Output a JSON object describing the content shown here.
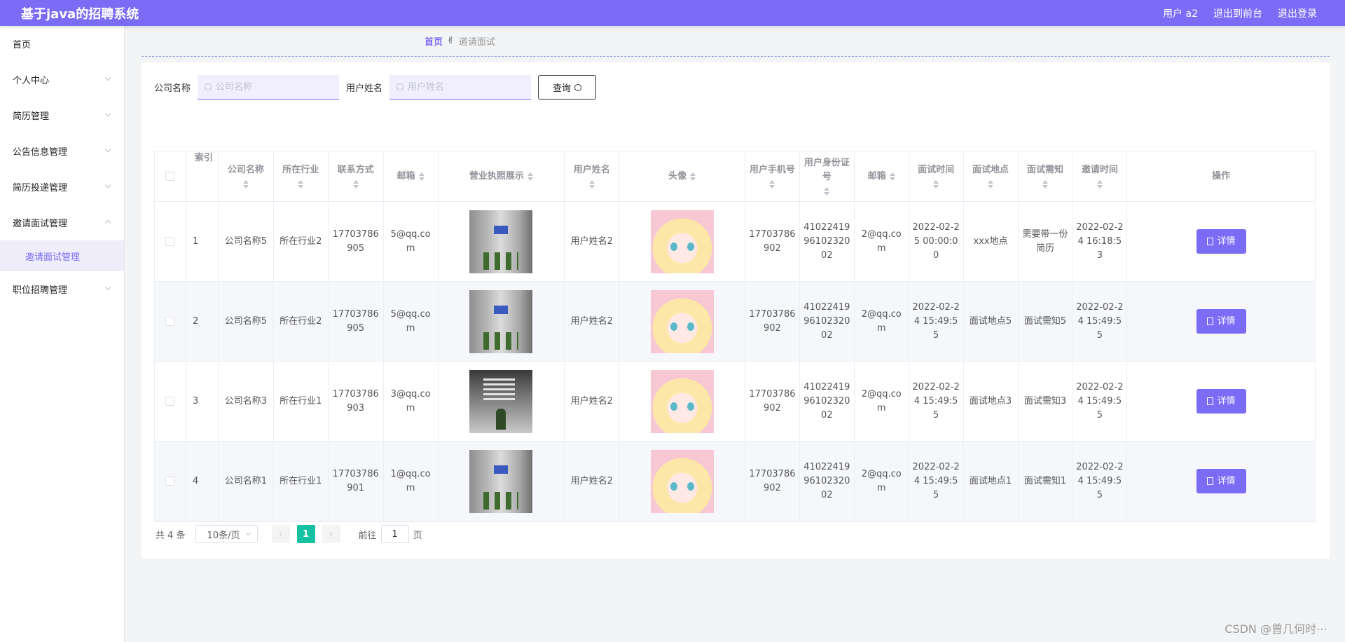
{
  "header": {
    "app_title": "基于java的招聘系统",
    "user": "用户 a2",
    "to_front": "退出到前台",
    "logout": "退出登录"
  },
  "sidebar": {
    "items": [
      {
        "label": "首页"
      },
      {
        "label": "个人中心"
      },
      {
        "label": "简历管理"
      },
      {
        "label": "公告信息管理"
      },
      {
        "label": "简历投递管理"
      },
      {
        "label": "邀请面试管理"
      },
      {
        "label": "职位招聘管理"
      }
    ],
    "sub_item": "邀请面试管理"
  },
  "breadcrumb": {
    "home": "首页",
    "separator": "✌",
    "current": "邀请面试"
  },
  "search": {
    "company_label": "公司名称",
    "company_placeholder": "公司名称",
    "user_label": "用户姓名",
    "user_placeholder": "用户姓名",
    "query_label": "查询"
  },
  "table": {
    "headers": [
      "索引",
      "公司名称",
      "所在行业",
      "联系方式",
      "邮箱",
      "营业执照展示",
      "用户姓名",
      "头像",
      "用户手机号",
      "用户身份证号",
      "邮箱",
      "面试时间",
      "面试地点",
      "面试需知",
      "邀请时间",
      "操作"
    ],
    "detail_label": "详情",
    "rows": [
      {
        "index": "1",
        "company": "公司名称5",
        "industry": "所在行业2",
        "contact": "17703786905",
        "email": "5@qq.com",
        "license_img": "office-lobby",
        "username": "用户姓名2",
        "avatar_img": "anime-avatar",
        "phone": "17703786902",
        "idcard": "410224199610232002",
        "user_email": "2@qq.com",
        "interview_time": "2022-02-25 00:00:00",
        "place": "xxx地点",
        "notice": "需要带一份简历",
        "invite_time": "2022-02-24 16:18:53"
      },
      {
        "index": "2",
        "company": "公司名称5",
        "industry": "所在行业2",
        "contact": "17703786905",
        "email": "5@qq.com",
        "license_img": "office-lobby",
        "username": "用户姓名2",
        "avatar_img": "anime-avatar",
        "phone": "17703786902",
        "idcard": "410224199610232002",
        "user_email": "2@qq.com",
        "interview_time": "2022-02-24 15:49:55",
        "place": "面试地点5",
        "notice": "面试需知5",
        "invite_time": "2022-02-24 15:49:55"
      },
      {
        "index": "3",
        "company": "公司名称3",
        "industry": "所在行业1",
        "contact": "17703786903",
        "email": "3@qq.com",
        "license_img": "office-dark",
        "username": "用户姓名2",
        "avatar_img": "anime-avatar",
        "phone": "17703786902",
        "idcard": "410224199610232002",
        "user_email": "2@qq.com",
        "interview_time": "2022-02-24 15:49:55",
        "place": "面试地点3",
        "notice": "面试需知3",
        "invite_time": "2022-02-24 15:49:55"
      },
      {
        "index": "4",
        "company": "公司名称1",
        "industry": "所在行业1",
        "contact": "17703786901",
        "email": "1@qq.com",
        "license_img": "office-lobby",
        "username": "用户姓名2",
        "avatar_img": "anime-avatar",
        "phone": "17703786902",
        "idcard": "410224199610232002",
        "user_email": "2@qq.com",
        "interview_time": "2022-02-24 15:49:55",
        "place": "面试地点1",
        "notice": "面试需知1",
        "invite_time": "2022-02-24 15:49:55"
      }
    ]
  },
  "pagination": {
    "total": "共 4 条",
    "page_size": "10条/页",
    "prev": "‹",
    "next": "›",
    "current_page": "1",
    "goto_prefix": "前往",
    "goto_value": "1",
    "goto_suffix": "页"
  },
  "watermark": "CSDN @曾几何时⋯",
  "colors": {
    "primary": "#7b6cf6",
    "pager_active": "#16c2a3"
  }
}
